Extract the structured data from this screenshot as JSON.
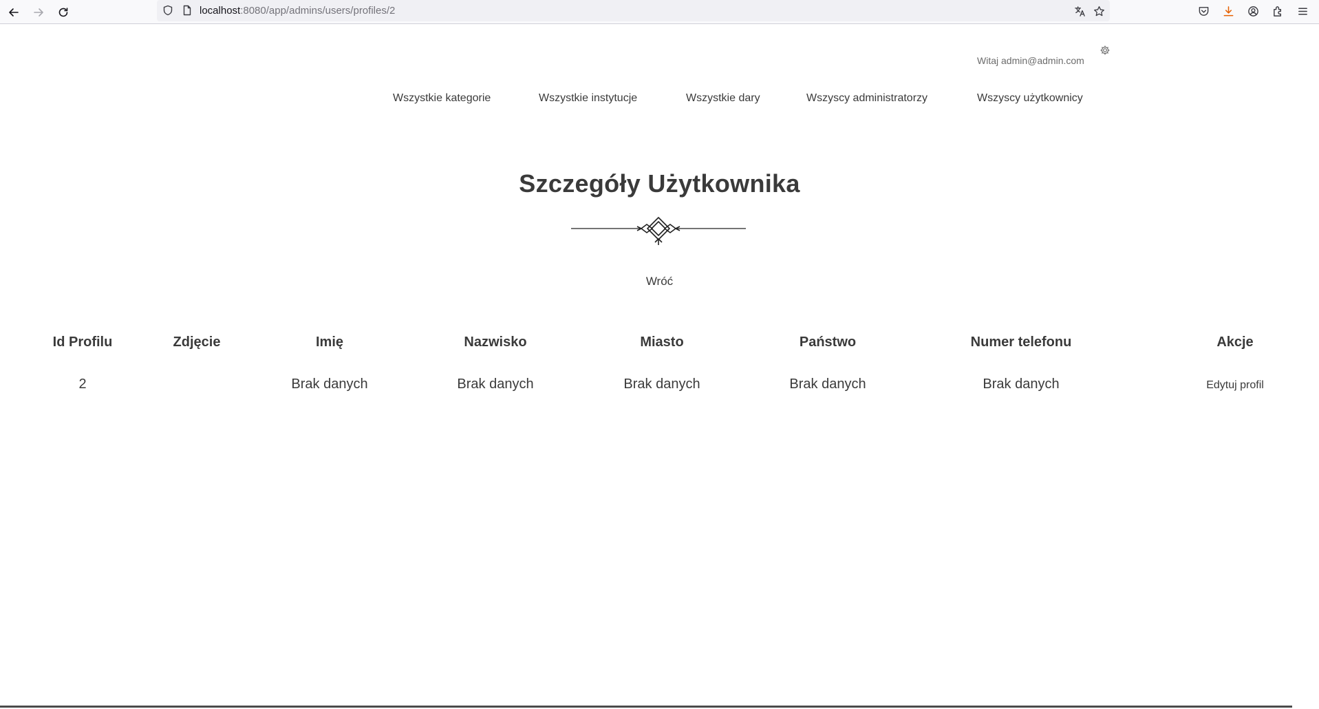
{
  "browser": {
    "url_host": "localhost",
    "url_rest": ":8080/app/admins/users/profiles/2",
    "icons": [
      "back-icon",
      "forward-icon",
      "reload-icon",
      "shield-icon",
      "page-icon",
      "translate-icon",
      "bookmark-star-icon",
      "pocket-icon",
      "download-icon",
      "account-icon",
      "extensions-icon",
      "menu-icon"
    ],
    "colors": {
      "download_accent": "#e66000"
    }
  },
  "header": {
    "greeting": "Witaj admin@admin.com",
    "settings_icon": "gear-icon"
  },
  "nav": {
    "items": [
      "Wszystkie kategorie",
      "Wszystkie instytucje",
      "Wszystkie dary",
      "Wszyscy administratorzy",
      "Wszyscy użytkownicy"
    ]
  },
  "main": {
    "title": "Szczegóły Użytkownika",
    "back_label": "Wróć"
  },
  "table": {
    "headers": [
      "Id Profilu",
      "Zdjęcie",
      "Imię",
      "Nazwisko",
      "Miasto",
      "Państwo",
      "Numer telefonu",
      "Akcje"
    ],
    "rows": [
      {
        "id": "2",
        "photo": "",
        "first_name": "Brak danych",
        "last_name": "Brak danych",
        "city": "Brak danych",
        "country": "Brak danych",
        "phone": "Brak danych",
        "action": "Edytuj profil"
      }
    ]
  }
}
